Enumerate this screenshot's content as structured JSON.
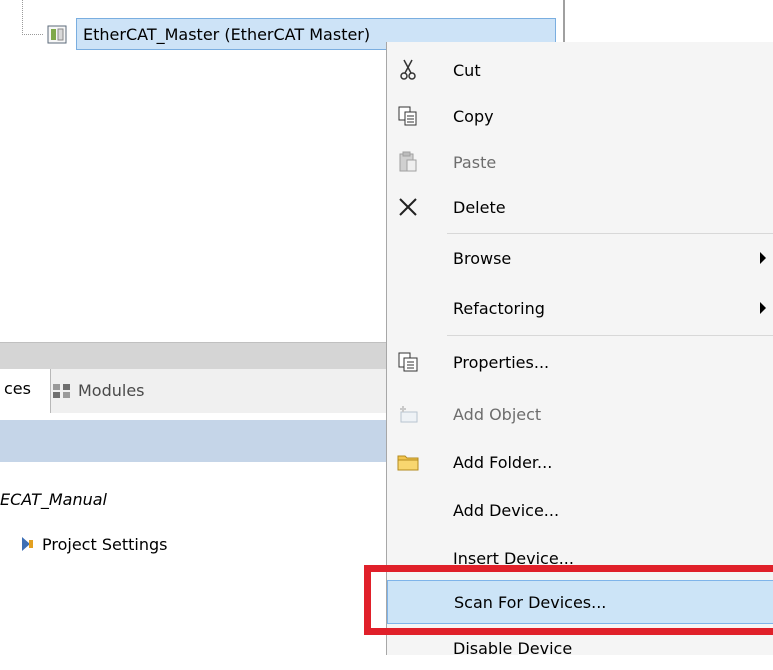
{
  "tree": {
    "master_node": "EtherCAT_Master (EtherCAT Master)"
  },
  "panel": {
    "tab_devices": "ces",
    "tab_modules": "Modules",
    "project_name": "ECAT_Manual",
    "project_settings": "Project Settings"
  },
  "menu": {
    "cut": "Cut",
    "copy": "Copy",
    "paste": "Paste",
    "delete": "Delete",
    "browse": "Browse",
    "refactoring": "Refactoring",
    "properties": "Properties...",
    "add_object": "Add Object",
    "add_folder": "Add Folder...",
    "add_device": "Add Device...",
    "insert_device": "Insert Device...",
    "scan_for_devices": "Scan For Devices...",
    "disable_device": "Disable Device"
  },
  "colors": {
    "highlight": "#cce4f7",
    "annotation": "#e0202a"
  }
}
